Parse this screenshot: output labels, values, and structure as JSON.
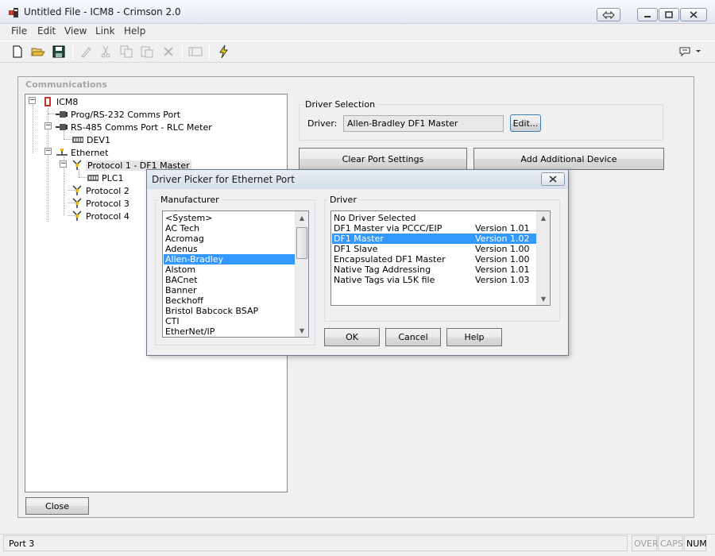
{
  "window": {
    "title": "Untitled File - ICM8 - Crimson 2.0"
  },
  "menu": [
    "File",
    "Edit",
    "View",
    "Link",
    "Help"
  ],
  "toolbar": {
    "icons": [
      "new-file-icon",
      "open-folder-icon",
      "save-icon",
      "edit-pen-icon",
      "cut-icon",
      "copy-icon",
      "paste-icon",
      "delete-icon",
      "properties-icon",
      "lightning-icon",
      "balloon-help-icon"
    ]
  },
  "communications": {
    "header": "Communications",
    "tree": {
      "root": "ICM8",
      "prog_port": "Prog/RS-232 Comms Port",
      "rs485_port": "RS-485 Comms Port - RLC Meter",
      "dev1": "DEV1",
      "ethernet": "Ethernet",
      "protocol1": "Protocol 1 - DF1 Master",
      "plc1": "PLC1",
      "protocol2": "Protocol 2",
      "protocol3": "Protocol 3",
      "protocol4": "Protocol 4"
    },
    "driver_selection": {
      "group_label": "Driver Selection",
      "label": "Driver:",
      "value": "Allen-Bradley DF1 Master",
      "edit_button": "Edit..."
    },
    "clear_button": "Clear Port Settings",
    "add_button": "Add Additional Device",
    "close_button": "Close"
  },
  "dialog": {
    "title": "Driver Picker for Ethernet Port",
    "manufacturer_label": "Manufacturer",
    "manufacturers": [
      "<System>",
      "AC Tech",
      "Acromag",
      "Adenus",
      "Allen-Bradley",
      "Alstom",
      "BACnet",
      "Banner",
      "Beckhoff",
      "Bristol Babcock BSAP",
      "CTI",
      "EtherNet/IP"
    ],
    "selected_manufacturer": "Allen-Bradley",
    "driver_label": "Driver",
    "drivers": [
      {
        "name": "No Driver Selected",
        "version": ""
      },
      {
        "name": "DF1 Master via PCCC/EIP",
        "version": "Version 1.01"
      },
      {
        "name": "DF1 Master",
        "version": "Version 1.02"
      },
      {
        "name": "DF1 Slave",
        "version": "Version 1.00"
      },
      {
        "name": "Encapsulated DF1 Master",
        "version": "Version 1.00"
      },
      {
        "name": "Native Tag Addressing",
        "version": "Version 1.01"
      },
      {
        "name": "Native Tags via L5K file",
        "version": "Version 1.03"
      }
    ],
    "selected_driver": "DF1 Master",
    "ok_button": "OK",
    "cancel_button": "Cancel",
    "help_button": "Help"
  },
  "statusbar": {
    "text": "Port 3",
    "over": "OVER",
    "caps": "CAPS",
    "num": "NUM"
  }
}
